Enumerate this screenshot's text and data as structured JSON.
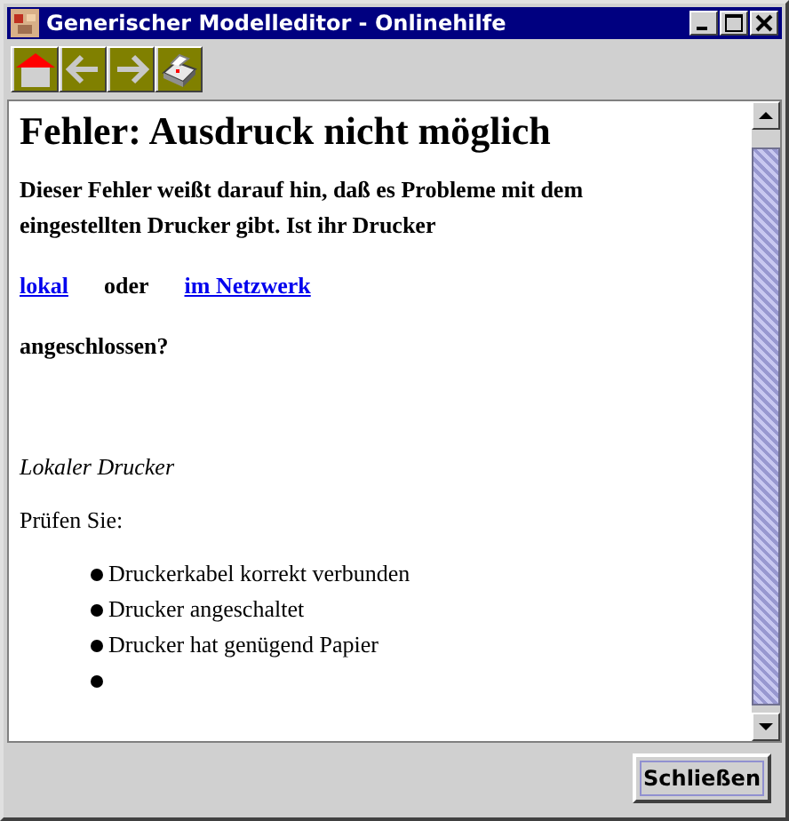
{
  "window": {
    "title": "Generischer Modelleditor - Onlinehilfe"
  },
  "toolbar": {
    "buttons": [
      {
        "kind": "home"
      },
      {
        "kind": "back"
      },
      {
        "kind": "forward"
      },
      {
        "kind": "print"
      }
    ]
  },
  "content": {
    "heading": "Fehler: Ausdruck nicht möglich",
    "intro": "Dieser Fehler weißt darauf hin, daß es Probleme mit dem eingestellten Drucker gibt. Ist ihr Drucker",
    "choice": {
      "link_1": "lokal ",
      "separator": "oder",
      "link_2": "im Netzwerk"
    },
    "question": "angeschlossen?",
    "section_title": "Lokaler Drucker",
    "check_label": "Prüfen Sie:",
    "items": [
      {
        "kind": "text",
        "text": "Druckerkabel korrekt verbunden"
      },
      {
        "kind": "text",
        "text": "Drucker angeschaltet"
      },
      {
        "kind": "text",
        "text": "Drucker hat genügend Papier"
      },
      {
        "kind": "empty"
      }
    ]
  },
  "buttons": [
    "Schließen"
  ]
}
